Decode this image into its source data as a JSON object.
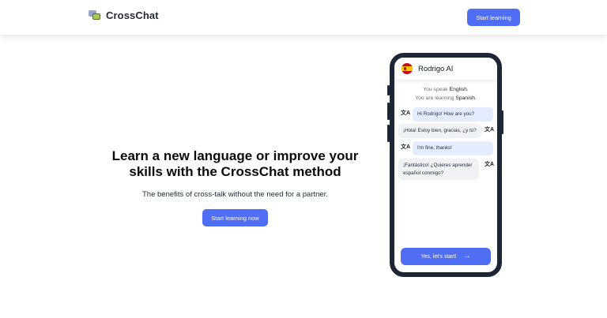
{
  "nav": {
    "brand": "CrossChat",
    "cta": "Start learning"
  },
  "hero": {
    "title_line1": "Learn a new language or improve your",
    "title_line2": "skills with the CrossChat method",
    "subtitle": "The benefits of cross-talk without the need for a partner.",
    "cta": "Start learning now"
  },
  "phone": {
    "ai_name": "Rodrigo AI",
    "speak_prefix": "You speak ",
    "speak_lang": "English",
    "speak_suffix": ".",
    "learn_prefix": "You are learning ",
    "learn_lang": "Spanish",
    "learn_suffix": ".",
    "messages": [
      {
        "from": "user",
        "text": "Hi Rodrigo! How are you?"
      },
      {
        "from": "ai",
        "text": "¡Hola! Estoy bien, gracias, ¿y tú?"
      },
      {
        "from": "user",
        "text": "I'm fine, thanks!"
      },
      {
        "from": "ai",
        "text": "¡Fantástico! ¿Quieres aprender español conmigo?"
      }
    ],
    "start_button": "Yes, let's start!",
    "arrow_glyph": "→",
    "translate_glyph": "文A"
  },
  "colors": {
    "accent": "#4f6df5",
    "phone_frame": "#1e2636",
    "user_bubble": "#e5ecff",
    "ai_bubble": "#f1f2f4"
  }
}
